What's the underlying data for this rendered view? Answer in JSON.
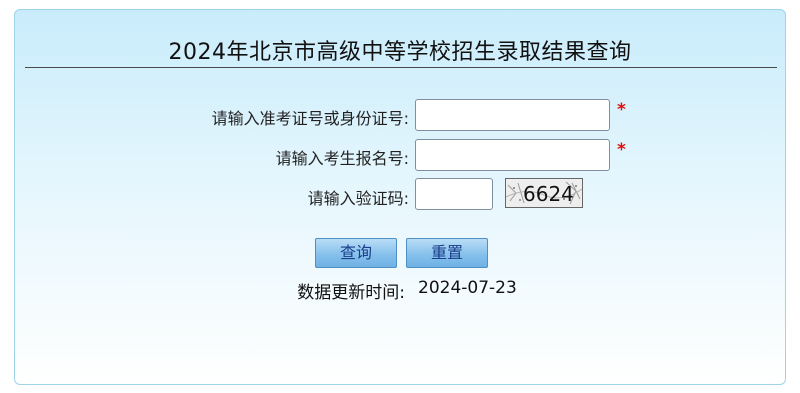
{
  "page": {
    "title": "2024年北京市高级中等学校招生录取结果查询"
  },
  "form": {
    "id_label": "请输入准考证号或身份证号:",
    "id_value": "",
    "id_required": "*",
    "reg_label": "请输入考生报名号:",
    "reg_value": "",
    "reg_required": "*",
    "captcha_label": "请输入验证码:",
    "captcha_value": "",
    "captcha_text": "6624"
  },
  "buttons": {
    "query_label": "查询",
    "reset_label": "重置"
  },
  "update": {
    "label": "数据更新时间:",
    "date": "2024-07-23"
  },
  "colors": {
    "button_text": "#1b3d8a",
    "required_mark": "#e01010",
    "panel_border": "#9fd3ea"
  }
}
